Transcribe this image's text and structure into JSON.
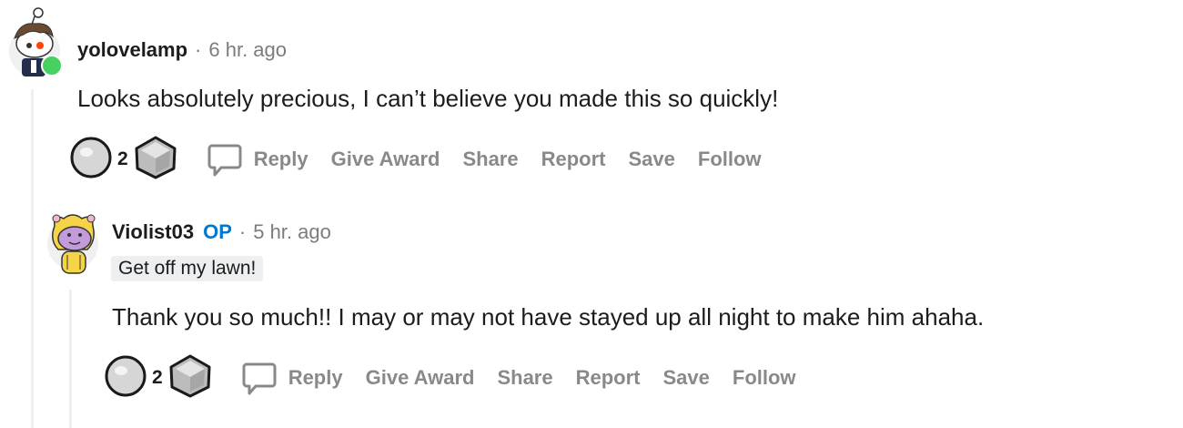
{
  "comments": [
    {
      "username": "yolovelamp",
      "separator": "·",
      "time": "6 hr. ago",
      "body": "Looks absolutely precious, I can’t believe you made this so quickly!",
      "score": "2",
      "actions": {
        "reply": "Reply",
        "award": "Give Award",
        "share": "Share",
        "report": "Report",
        "save": "Save",
        "follow": "Follow"
      },
      "online": true
    },
    {
      "username": "Violist03",
      "op_badge": "OP",
      "separator": "·",
      "time": "5 hr. ago",
      "flair": "Get off my lawn!",
      "body": "Thank you so much!! I may or may not have stayed up all night to make him ahaha.",
      "score": "2",
      "actions": {
        "reply": "Reply",
        "award": "Give Award",
        "share": "Share",
        "report": "Report",
        "save": "Save",
        "follow": "Follow"
      }
    }
  ],
  "colors": {
    "online": "#46d160",
    "op": "#0079d3",
    "action_text": "#878a8c",
    "thread_line": "#edeff1"
  }
}
